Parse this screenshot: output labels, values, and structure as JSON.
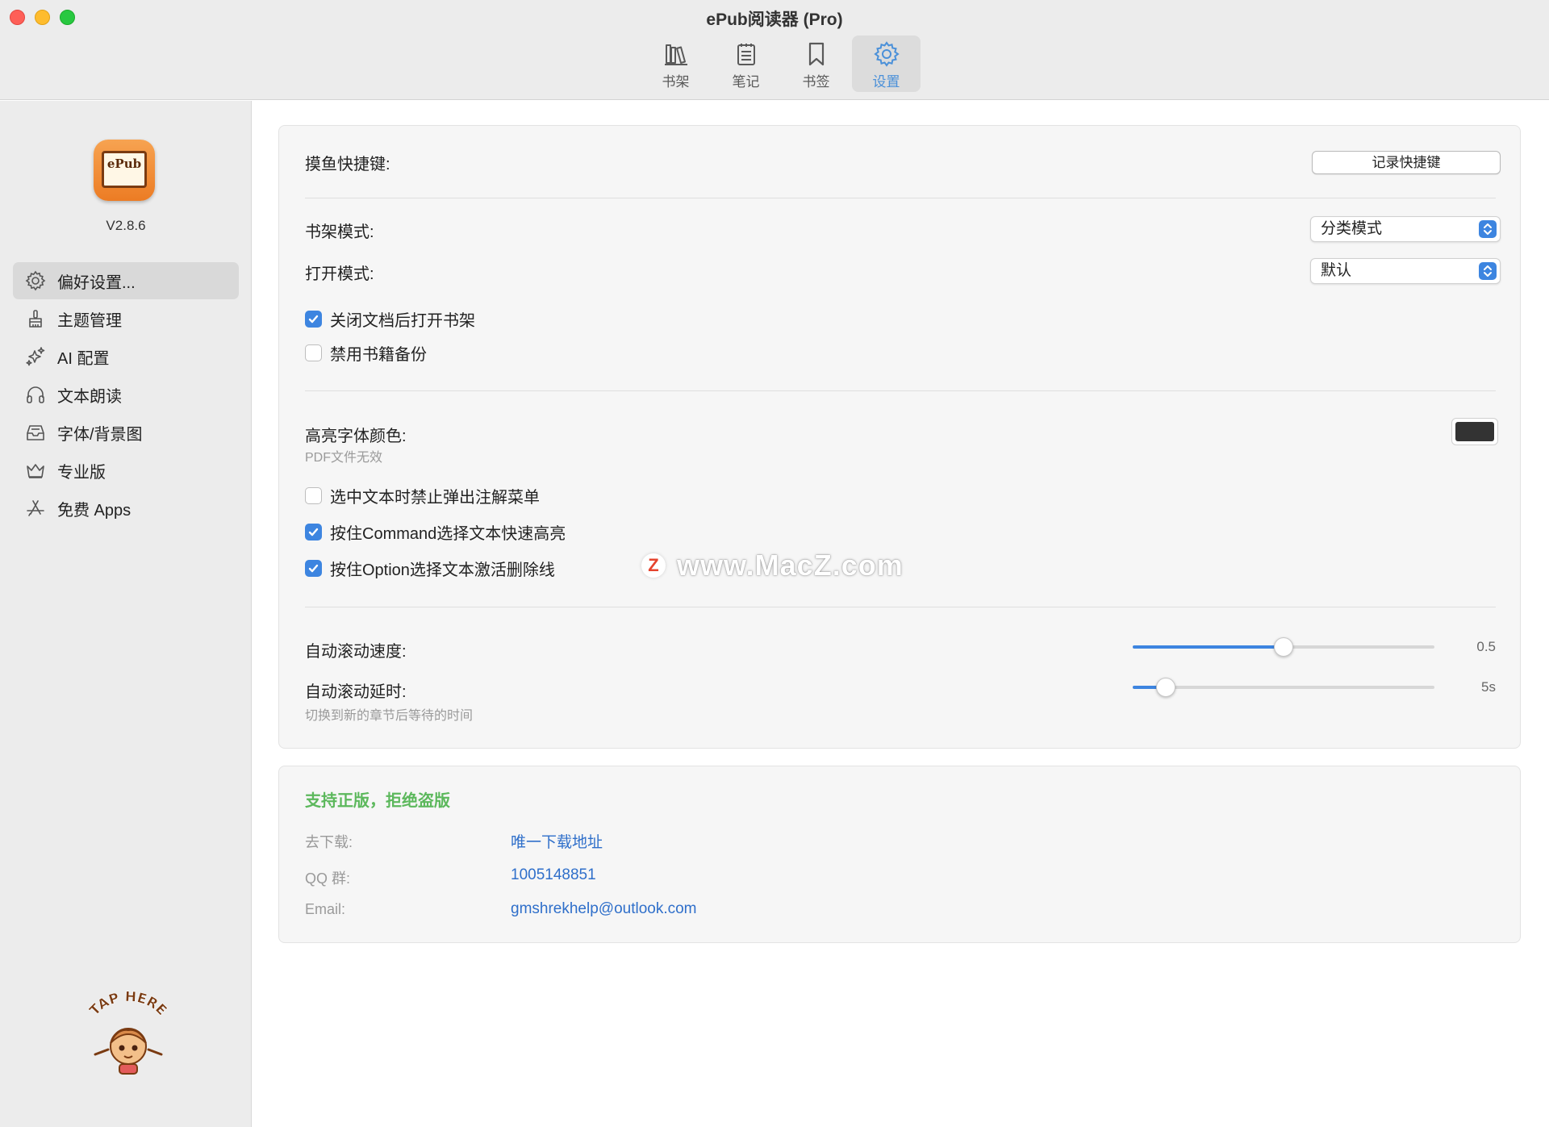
{
  "window": {
    "title": "ePub阅读器 (Pro)"
  },
  "toolbar": {
    "tabs": [
      {
        "label": "书架",
        "icon": "bookshelf-icon"
      },
      {
        "label": "笔记",
        "icon": "notes-icon"
      },
      {
        "label": "书签",
        "icon": "bookmark-icon"
      },
      {
        "label": "设置",
        "icon": "gear-icon",
        "active": true
      }
    ]
  },
  "sidebar": {
    "app_icon_text": "ePub",
    "version": "V2.8.6",
    "items": [
      {
        "label": "偏好设置...",
        "icon": "gear-icon",
        "active": true
      },
      {
        "label": "主题管理",
        "icon": "brush-icon"
      },
      {
        "label": "AI 配置",
        "icon": "sparkles-icon"
      },
      {
        "label": "文本朗读",
        "icon": "headphones-icon"
      },
      {
        "label": "字体/背景图",
        "icon": "tray-icon"
      },
      {
        "label": "专业版",
        "icon": "crown-icon"
      },
      {
        "label": "免费 Apps",
        "icon": "app-store-icon"
      }
    ],
    "mascot_text": "TAP HERE"
  },
  "settings": {
    "shortcut_label": "摸鱼快捷键:",
    "record_button": "记录快捷键",
    "shelf_mode_label": "书架模式:",
    "shelf_mode_value": "分类模式",
    "open_mode_label": "打开模式:",
    "open_mode_value": "默认",
    "checks_a": [
      {
        "label": "关闭文档后打开书架",
        "checked": true
      },
      {
        "label": "禁用书籍备份",
        "checked": false
      }
    ],
    "highlight_color_label": "高亮字体颜色:",
    "highlight_color_hint": "PDF文件无效",
    "highlight_color": "#333333",
    "checks_b": [
      {
        "label": "选中文本时禁止弹出注解菜单",
        "checked": false
      },
      {
        "label": "按住Command选择文本快速高亮",
        "checked": true
      },
      {
        "label": "按住Option选择文本激活删除线",
        "checked": true
      }
    ],
    "scroll_speed_label": "自动滚动速度:",
    "scroll_speed_value": "0.5",
    "scroll_speed_fraction": 0.5,
    "scroll_delay_label": "自动滚动延时:",
    "scroll_delay_value": "5s",
    "scroll_delay_fraction": 0.11,
    "scroll_delay_hint": "切换到新的章节后等待的时间"
  },
  "support": {
    "title": "支持正版，拒绝盗版",
    "download_key": "去下载:",
    "download_val": "唯一下载地址",
    "qq_key": "QQ 群:",
    "qq_val": "1005148851",
    "email_key": "Email:",
    "email_val": "gmshrekhelp@outlook.com"
  },
  "watermark": {
    "logo": "Z",
    "text": "www.MacZ.com"
  },
  "colors": {
    "accent": "#3d85e0",
    "link": "#2f6fca",
    "support_title": "#5cb85c"
  }
}
